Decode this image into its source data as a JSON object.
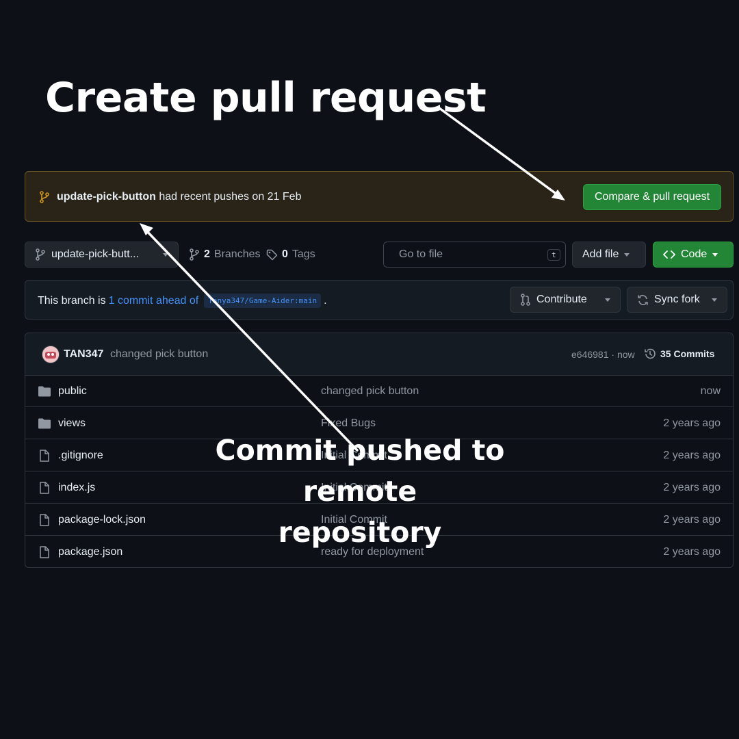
{
  "annotations": {
    "title": "Create pull request",
    "commit_note_line1": "Commit pushed to remote",
    "commit_note_line2": "repository"
  },
  "banner": {
    "branch": "update-pick-button",
    "text": " had recent pushes on 21 Feb",
    "button": "Compare & pull request"
  },
  "toolbar": {
    "branch_button": "update-pick-butt...",
    "branches_count": "2",
    "branches_label": "Branches",
    "tags_count": "0",
    "tags_label": "Tags",
    "search_placeholder": "Go to file",
    "search_shortcut": "t",
    "add_file": "Add file",
    "code": "Code"
  },
  "ahead": {
    "prefix": "This branch is",
    "link": "1 commit ahead of",
    "ref": "Tanya347/Game-Aider:main",
    "suffix": ".",
    "contribute": "Contribute",
    "sync_fork": "Sync fork"
  },
  "latest_commit": {
    "author": "TAN347",
    "message": "changed pick button",
    "sha_time": "e646981 · now",
    "commits_count": "35 Commits"
  },
  "files": [
    {
      "type": "dir",
      "name": "public",
      "message": "changed pick button",
      "age": "now"
    },
    {
      "type": "dir",
      "name": "views",
      "message": "Fixed Bugs",
      "age": "2 years ago"
    },
    {
      "type": "file",
      "name": ".gitignore",
      "message": "Initial Commit",
      "age": "2 years ago"
    },
    {
      "type": "file",
      "name": "index.js",
      "message": "Initial Commit",
      "age": "2 years ago"
    },
    {
      "type": "file",
      "name": "package-lock.json",
      "message": "Initial Commit",
      "age": "2 years ago"
    },
    {
      "type": "file",
      "name": "package.json",
      "message": "ready for deployment",
      "age": "2 years ago"
    }
  ],
  "colors": {
    "background": "#0d1117",
    "accent_green": "#238636",
    "link_blue": "#4493f8",
    "banner_bg": "#2a2418",
    "branch_icon": "#d29922"
  }
}
